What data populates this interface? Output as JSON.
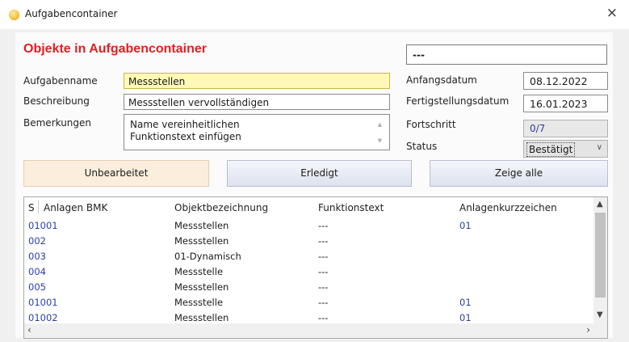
{
  "window": {
    "title": "Aufgabencontainer",
    "close_icon": "×"
  },
  "form": {
    "heading": "Objekte in Aufgabencontainer",
    "top_field_value": "---",
    "labels": {
      "aufgabenname": "Aufgabenname",
      "beschreibung": "Beschreibung",
      "bemerkungen": "Bemerkungen",
      "anfangsdatum": "Anfangsdatum",
      "fertigstellungsdatum": "Fertigstellungsdatum",
      "fortschritt": "Fortschritt",
      "status": "Status"
    },
    "aufgabenname": "Messstellen",
    "beschreibung": "Messstellen vervollständigen",
    "bemerkungen": [
      "Name vereinheitlichen",
      "Funktionstext einfügen"
    ],
    "anfangsdatum": "08.12.2022",
    "fertigstellungsdatum": "16.01.2023",
    "fortschritt": "0/7",
    "status": "Bestätigt"
  },
  "buttons": {
    "unbearbeitet": "Unbearbeitet",
    "erledigt": "Erledigt",
    "zeige_alle": "Zeige alle"
  },
  "table": {
    "headers": {
      "s": "S",
      "anlagen_bmk": "Anlagen BMK",
      "objektbezeichnung": "Objektbezeichnung",
      "funktionstext": "Funktionstext",
      "anlagenkurzzeichen": "Anlagenkurzzeichen"
    },
    "rows": [
      {
        "bmk": "01001",
        "obj": "Messstellen",
        "fkt": "---",
        "akz": "01"
      },
      {
        "bmk": "002",
        "obj": "Messstellen",
        "fkt": "---",
        "akz": ""
      },
      {
        "bmk": "003",
        "obj": "01-Dynamisch",
        "fkt": "---",
        "akz": ""
      },
      {
        "bmk": "004",
        "obj": "Messstelle",
        "fkt": "---",
        "akz": ""
      },
      {
        "bmk": "005",
        "obj": "Messstellen",
        "fkt": "---",
        "akz": ""
      },
      {
        "bmk": "01001",
        "obj": "Messstelle",
        "fkt": "---",
        "akz": "01"
      },
      {
        "bmk": "01002",
        "obj": "Messstellen",
        "fkt": "---",
        "akz": "01"
      }
    ]
  },
  "colors": {
    "heading": "#e02020",
    "link_blue": "#2b3fa8",
    "highlight_field": "#fff8b8",
    "unbearbeitet_button": "#fbeedd"
  },
  "icons": [
    "app-icon",
    "close-icon",
    "chevron-down-icon",
    "scroll-up-icon",
    "scroll-down-icon",
    "scroll-left-icon",
    "scroll-right-icon"
  ]
}
